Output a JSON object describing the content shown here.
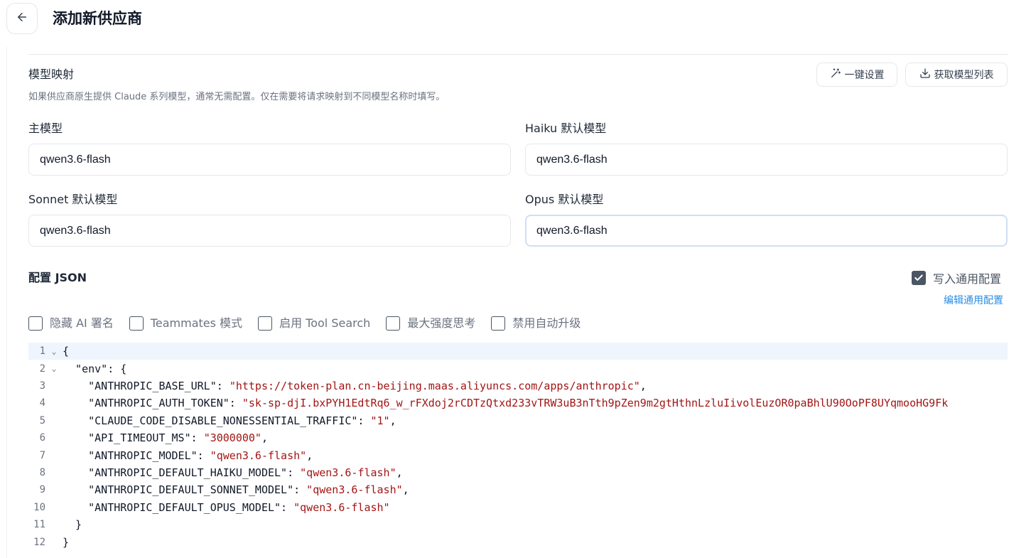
{
  "header": {
    "back_icon": "arrow-left-icon",
    "title": "添加新供应商"
  },
  "model_mapping": {
    "title": "模型映射",
    "description": "如果供应商原生提供 Claude 系列模型，通常无需配置。仅在需要将请求映射到不同模型名称时填写。",
    "one_click_label": "一键设置",
    "fetch_models_label": "获取模型列表",
    "fields": {
      "main": {
        "label": "主模型",
        "value": "qwen3.6-flash"
      },
      "haiku": {
        "label": "Haiku 默认模型",
        "value": "qwen3.6-flash"
      },
      "sonnet": {
        "label": "Sonnet 默认模型",
        "value": "qwen3.6-flash"
      },
      "opus": {
        "label": "Opus 默认模型",
        "value": "qwen3.6-flash"
      }
    }
  },
  "config_json": {
    "title": "配置 JSON",
    "write_common_label": "写入通用配置",
    "write_common_checked": true,
    "edit_common_label": "编辑通用配置",
    "options": [
      {
        "label": "隐藏 AI 署名",
        "checked": false
      },
      {
        "label": "Teammates 模式",
        "checked": false
      },
      {
        "label": "启用 Tool Search",
        "checked": false
      },
      {
        "label": "最大强度思考",
        "checked": false
      },
      {
        "label": "禁用自动升级",
        "checked": false
      }
    ]
  },
  "editor": {
    "lines": [
      {
        "n": "1",
        "fold": true,
        "parts": [
          {
            "t": "{",
            "s": false
          }
        ]
      },
      {
        "n": "2",
        "fold": true,
        "parts": [
          {
            "t": "  \"env\": {",
            "s": false
          }
        ]
      },
      {
        "n": "3",
        "fold": false,
        "parts": [
          {
            "t": "    \"ANTHROPIC_BASE_URL\": ",
            "s": false
          },
          {
            "t": "\"https://token-plan.cn-beijing.maas.aliyuncs.com/apps/anthropic\"",
            "s": true
          },
          {
            "t": ",",
            "s": false
          }
        ]
      },
      {
        "n": "4",
        "fold": false,
        "parts": [
          {
            "t": "    \"ANTHROPIC_AUTH_TOKEN\": ",
            "s": false
          },
          {
            "t": "\"sk-sp-djI.bxPYH1EdtRq6_w_rFXdoj2rCDTzQtxd233vTRW3uB3nTth9pZen9m2gtHthnLzluIivolEuzOR0paBhlU90OoPF8UYqmooHG9Fk",
            "s": true
          }
        ]
      },
      {
        "n": "5",
        "fold": false,
        "parts": [
          {
            "t": "    \"CLAUDE_CODE_DISABLE_NONESSENTIAL_TRAFFIC\": ",
            "s": false
          },
          {
            "t": "\"1\"",
            "s": true
          },
          {
            "t": ",",
            "s": false
          }
        ]
      },
      {
        "n": "6",
        "fold": false,
        "parts": [
          {
            "t": "    \"API_TIMEOUT_MS\": ",
            "s": false
          },
          {
            "t": "\"3000000\"",
            "s": true
          },
          {
            "t": ",",
            "s": false
          }
        ]
      },
      {
        "n": "7",
        "fold": false,
        "parts": [
          {
            "t": "    \"ANTHROPIC_MODEL\": ",
            "s": false
          },
          {
            "t": "\"qwen3.6-flash\"",
            "s": true
          },
          {
            "t": ",",
            "s": false
          }
        ]
      },
      {
        "n": "8",
        "fold": false,
        "parts": [
          {
            "t": "    \"ANTHROPIC_DEFAULT_HAIKU_MODEL\": ",
            "s": false
          },
          {
            "t": "\"qwen3.6-flash\"",
            "s": true
          },
          {
            "t": ",",
            "s": false
          }
        ]
      },
      {
        "n": "9",
        "fold": false,
        "parts": [
          {
            "t": "    \"ANTHROPIC_DEFAULT_SONNET_MODEL\": ",
            "s": false
          },
          {
            "t": "\"qwen3.6-flash\"",
            "s": true
          },
          {
            "t": ",",
            "s": false
          }
        ]
      },
      {
        "n": "10",
        "fold": false,
        "parts": [
          {
            "t": "    \"ANTHROPIC_DEFAULT_OPUS_MODEL\": ",
            "s": false
          },
          {
            "t": "\"qwen3.6-flash\"",
            "s": true
          }
        ]
      },
      {
        "n": "11",
        "fold": false,
        "parts": [
          {
            "t": "  }",
            "s": false
          }
        ]
      },
      {
        "n": "12",
        "fold": false,
        "parts": [
          {
            "t": "}",
            "s": false
          }
        ]
      }
    ]
  },
  "colors": {
    "string": "#a31515",
    "link": "#2b8de3",
    "active_line": "#eef5fd",
    "checkbox_checked": "#4b5563"
  }
}
